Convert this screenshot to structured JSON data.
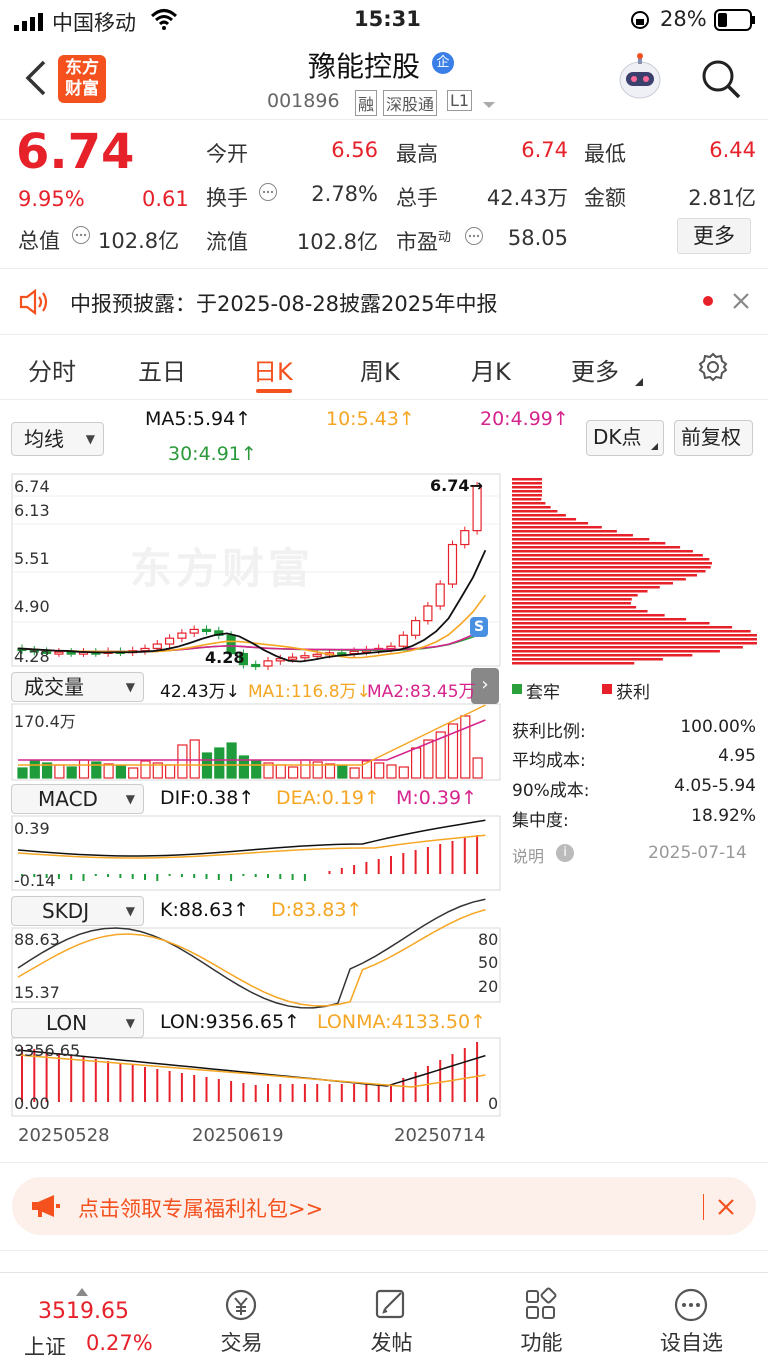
{
  "status": {
    "carrier": "中国移动",
    "time": "15:31",
    "battery": "28%"
  },
  "header": {
    "logo_line1": "东方",
    "logo_line2": "财富",
    "title": "豫能控股",
    "title_badge": "企",
    "code": "001896",
    "tags": [
      "融",
      "深股通",
      "L1"
    ]
  },
  "quote": {
    "price": "6.74",
    "change_pct": "9.95%",
    "change": "0.61",
    "total_value_label": "总值",
    "total_value": "102.8亿",
    "fields": [
      {
        "label": "今开",
        "value": "6.56",
        "color": "#e6212a"
      },
      {
        "label": "最高",
        "value": "6.74",
        "color": "#e6212a"
      },
      {
        "label": "最低",
        "value": "6.44",
        "color": "#e6212a"
      },
      {
        "label": "换手",
        "value": "2.78%",
        "color": "#333333"
      },
      {
        "label": "总手",
        "value": "42.43万",
        "color": "#333333"
      },
      {
        "label": "金额",
        "value": "2.81亿",
        "color": "#333333"
      },
      {
        "label": "流值",
        "value": "102.8亿",
        "color": "#333333"
      },
      {
        "label": "市盈",
        "label_sup": "动",
        "value": "58.05",
        "color": "#333333"
      }
    ],
    "more_button": "更多"
  },
  "notice": {
    "text": "中报预披露：于2025-08-28披露2025年中报"
  },
  "tabs": {
    "items": [
      "分时",
      "五日",
      "日K",
      "周K",
      "月K",
      "更多"
    ],
    "active": 2
  },
  "ma_bar": {
    "select": "均线",
    "ma5": "MA5:5.94↑",
    "ma10": "10:5.43↑",
    "ma20": "20:4.99↑",
    "ma30": "30:4.91↑",
    "dk_button": "DK点",
    "fq_button": "前复权"
  },
  "kline": {
    "y_labels": [
      "6.74",
      "6.13",
      "5.51",
      "4.90",
      "4.28"
    ],
    "high_label": "6.74→",
    "low_label": "4.28",
    "watermark": "东方财富",
    "volume_select": "成交量",
    "volume_vals": "42.43万↓",
    "volume_ma1": "MA1:116.8万↓",
    "volume_ma2": "MA2:83.45万",
    "volume_max": "170.4万",
    "macd_select": "MACD",
    "dif": "DIF:0.38↑",
    "dea": "DEA:0.19↑",
    "m": "M:0.39↑",
    "macd_top": "0.39",
    "macd_bottom": "-0.14",
    "kdj_select": "SKDJ",
    "k": "K:88.63↑",
    "d": "D:83.83↑",
    "kdj_top": "88.63",
    "kdj_bottom": "15.37",
    "kdj_right": [
      "80",
      "50",
      "20"
    ],
    "lon_select": "LON",
    "lon": "LON:9356.65↑",
    "lonma": "LONMA:4133.50↑",
    "lon_top": "9356.65",
    "lon_bottom": "0.00",
    "lon_right": "0",
    "dates": [
      "20250528",
      "20250619",
      "20250714"
    ]
  },
  "chip": {
    "legend_trap": "套牢",
    "legend_profit": "获利",
    "rows": [
      {
        "label": "获利比例:",
        "value": "100.00%"
      },
      {
        "label": "平均成本:",
        "value": "4.95"
      },
      {
        "label": "90%成本:",
        "value": "4.05-5.94"
      },
      {
        "label": "集中度:",
        "value": "18.92%"
      }
    ],
    "note_label": "说明",
    "date": "2025-07-14"
  },
  "promo": {
    "text": "点击领取专属福利礼包>>"
  },
  "bottom": {
    "index_value": "3519.65",
    "index_name": "上证",
    "index_pct": "0.27%",
    "tabs": [
      "交易",
      "发帖",
      "功能",
      "设自选"
    ]
  }
}
